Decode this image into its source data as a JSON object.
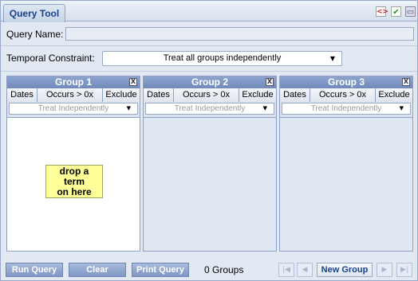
{
  "tab": {
    "label": "Query Tool"
  },
  "toolbar_icons": [
    "xml-icon",
    "check-icon",
    "window-icon"
  ],
  "query_name": {
    "label": "Query Name:",
    "value": ""
  },
  "temporal": {
    "label": "Temporal Constraint:",
    "selected": "Treat all groups independently"
  },
  "group_buttons": {
    "dates": "Dates",
    "occurs": "Occurs > 0x",
    "exclude": "Exclude"
  },
  "groups": [
    {
      "title": "Group 1",
      "close": "X",
      "timing": "Treat Independently"
    },
    {
      "title": "Group 2",
      "close": "X",
      "timing": "Treat Independently"
    },
    {
      "title": "Group 3",
      "close": "X",
      "timing": "Treat Independently"
    }
  ],
  "drop_hint": {
    "line1": "drop a",
    "line2": "term",
    "line3": "on here"
  },
  "bottom": {
    "run_query": "Run Query",
    "clear": "Clear",
    "print_query": "Print Query",
    "groups_count": "0 Groups",
    "new_group": "New Group"
  },
  "colors": {
    "header": "#7c94c4",
    "background": "#e3e9f3",
    "hint": "#ffff99"
  }
}
